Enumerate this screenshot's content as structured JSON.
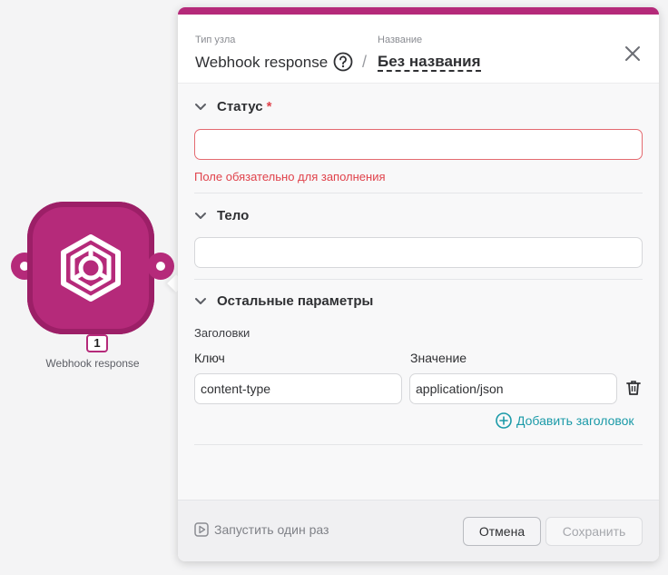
{
  "canvas": {
    "node": {
      "number": "1",
      "label": "Webhook response",
      "color": "#b52a7a"
    }
  },
  "panel": {
    "accent_color": "#b52a7a",
    "header": {
      "type_caption": "Тип узла",
      "type_value": "Webhook response",
      "name_caption": "Название",
      "name_value": "Без названия"
    },
    "sections": {
      "status": {
        "title": "Статус",
        "required_mark": "*",
        "value": "",
        "error": "Поле обязательно для заполнения"
      },
      "body": {
        "title": "Тело",
        "value": ""
      },
      "other": {
        "title": "Остальные параметры",
        "headers_label": "Заголовки",
        "key_label": "Ключ",
        "value_label": "Значение",
        "rows": [
          {
            "key": "content-type",
            "value": "application/json"
          }
        ],
        "add_label": "Добавить заголовок"
      }
    },
    "footer": {
      "run_once_label": "Запустить один раз",
      "cancel_label": "Отмена",
      "save_label": "Сохранить"
    }
  }
}
